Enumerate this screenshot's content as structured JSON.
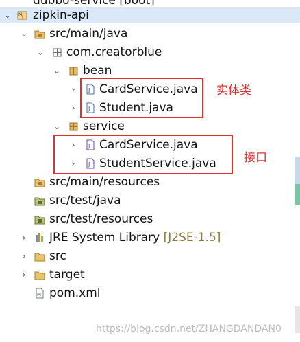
{
  "tree": {
    "partial_top": "dubbo-service [boot]",
    "project": "zipkin-api",
    "src_main_java": "src/main/java",
    "package": "com.creatorblue",
    "pkg_bean": "bean",
    "bean_files": [
      "CardService.java",
      "Student.java"
    ],
    "pkg_service": "service",
    "service_files": [
      "CardService.java",
      "StudentService.java"
    ],
    "src_main_resources": "src/main/resources",
    "src_test_java": "src/test/java",
    "src_test_resources": "src/test/resources",
    "jre": "JRE System Library",
    "jre_version": "[J2SE-1.5]",
    "src": "src",
    "target": "target",
    "pom": "pom.xml"
  },
  "annotations": {
    "entity": "实体类",
    "interface": "接口"
  },
  "watermark": "https://blog.csdn.net/ZHANGDANDAN0",
  "colors": {
    "selection": "#dbe8f8",
    "annotation": "#e0302c"
  }
}
